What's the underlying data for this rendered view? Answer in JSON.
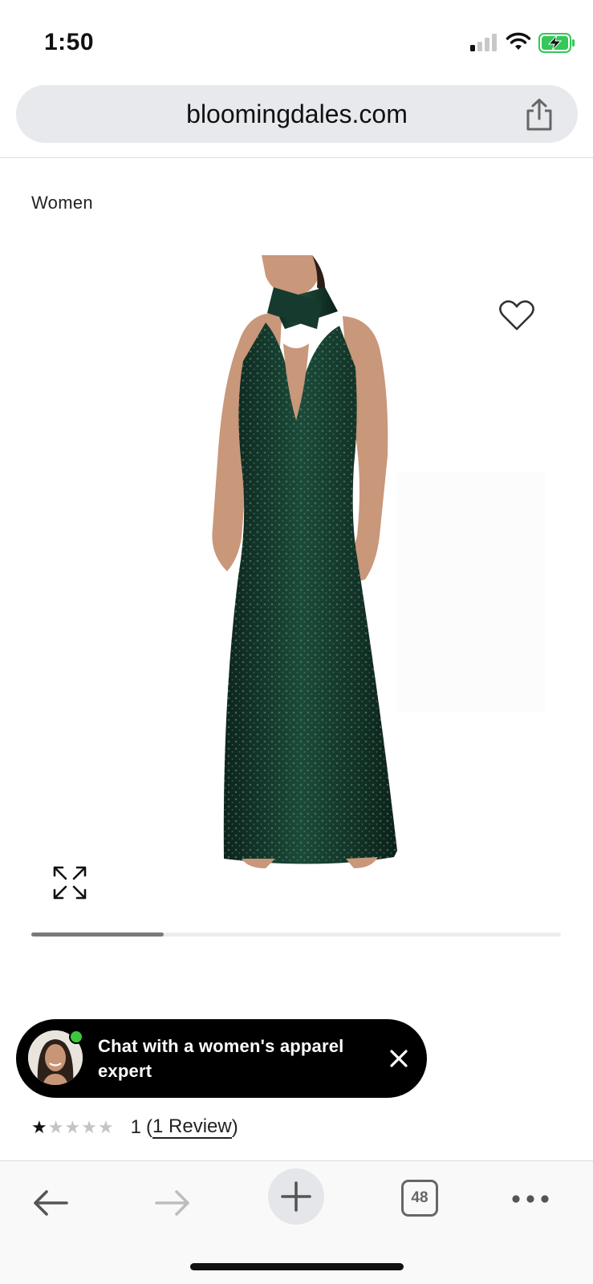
{
  "status_bar": {
    "time": "1:50",
    "icons": [
      "cellular-signal-icon",
      "wifi-icon",
      "battery-charging-icon"
    ],
    "battery_color": "#34c759"
  },
  "browser": {
    "url": "bloomingdales.com",
    "share_icon": "share-icon"
  },
  "breadcrumb": {
    "label": "Women"
  },
  "product": {
    "image_alt": "dark green sequin halter gown on model",
    "dress_color": "#0f2c22",
    "wishlist_icon": "heart-icon",
    "expand_icon": "expand-icon",
    "carousel_progress": 0.25
  },
  "chat": {
    "text": "Chat with a women's apparel expert",
    "close_icon": "close-icon",
    "online_color": "#3cc83c"
  },
  "rating": {
    "stars_filled": 1,
    "stars_total": 5,
    "count": "1",
    "open_paren": "(",
    "review_link": "1 Review",
    "close_paren": ")"
  },
  "toolbar": {
    "back_icon": "back-arrow-icon",
    "forward_icon": "forward-arrow-icon",
    "new_tab_icon": "plus-icon",
    "tab_count": "48",
    "more_icon": "more-icon"
  }
}
